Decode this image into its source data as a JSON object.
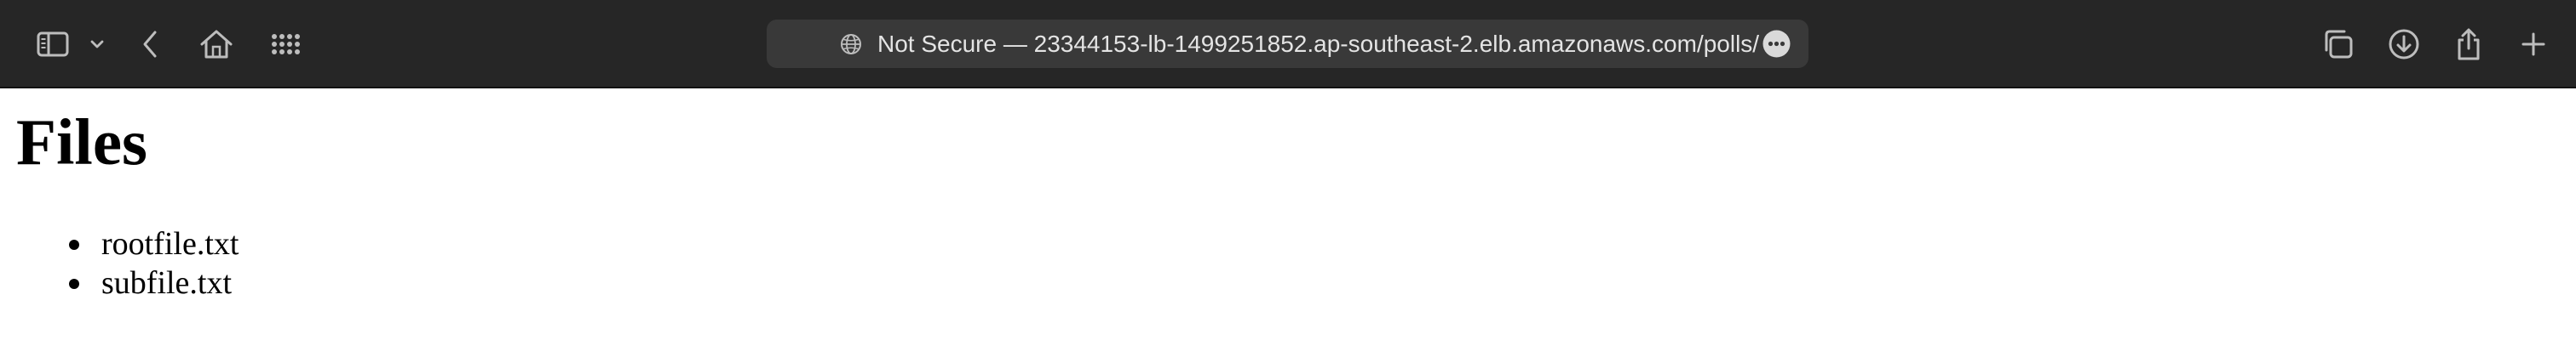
{
  "browser": {
    "address_bar": {
      "security_label": "Not Secure",
      "separator": "—",
      "url": "23344153-lb-1499251852.ap-southeast-2.elb.amazonaws.com/polls/",
      "display_text": "Not Secure — 23344153-lb-1499251852.ap-southeast-2.elb.amazonaws.com/polls/"
    },
    "toolbar_icons": [
      "sidebar-icon",
      "chevron-down-icon",
      "back-icon",
      "home-icon",
      "grid-icon",
      "globe-icon",
      "more-icon",
      "tabs-overview-icon",
      "download-icon",
      "share-icon",
      "new-tab-icon"
    ],
    "colors": {
      "toolbar_bg": "#262626",
      "address_bg": "#393939",
      "icon_color": "#bdbdbd",
      "text_color": "#e4e4e4"
    }
  },
  "page": {
    "heading": "Files",
    "files": [
      {
        "name": "rootfile.txt"
      },
      {
        "name": "subfile.txt"
      }
    ]
  }
}
